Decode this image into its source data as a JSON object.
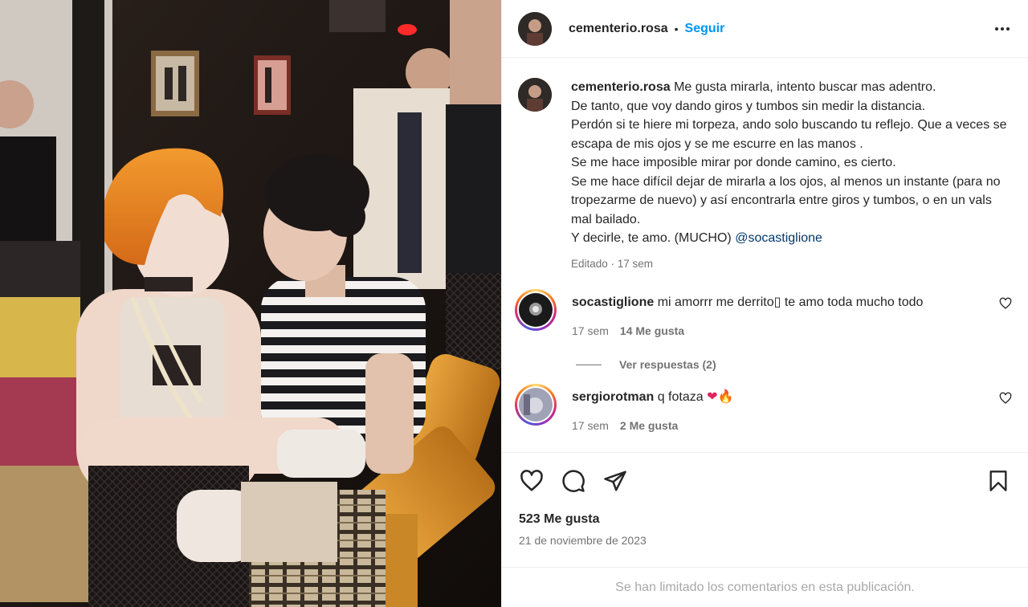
{
  "post": {
    "username": "cementerio.rosa",
    "dot": "•",
    "follow_label": "Seguir",
    "more_icon": "more-horizontal-icon"
  },
  "caption": {
    "username": "cementerio.rosa",
    "text": "Me gusta mirarla, intento buscar mas adentro.\nDe tanto, que voy dando giros y tumbos sin medir la distancia.\nPerdón si te hiere mi torpeza, ando solo buscando tu reflejo. Que a veces se escapa de mis ojos y se me escurre en las manos .\nSe me hace imposible mirar por donde camino, es cierto.\nSe me hace difícil dejar de mirarla a los ojos, al menos un instante (para no tropezarme de nuevo) y así encontrarla entre giros y tumbos, o en un vals mal bailado.\nY decirle, te amo. (MUCHO) ",
    "mention": "@socastiglione",
    "meta": "Editado · 17 sem"
  },
  "comments": [
    {
      "username": "socastiglione",
      "text": "mi amorrr me derrito▯ te amo toda mucho todo",
      "time": "17 sem",
      "likes": "14 Me gusta",
      "replies_label": "Ver respuestas (2)"
    },
    {
      "username": "sergiorotman",
      "text": "q fotaza ",
      "emoji": "❤🔥",
      "time": "17 sem",
      "likes": "2 Me gusta"
    }
  ],
  "engagement": {
    "likes": "523 Me gusta",
    "date": "21 de noviembre de 2023"
  },
  "footer": {
    "notice": "Se han limitado los comentarios en esta publicación."
  },
  "colors": {
    "link": "#0095f6",
    "mention": "#00376b",
    "muted": "#737373",
    "heart": "#ed4956"
  }
}
